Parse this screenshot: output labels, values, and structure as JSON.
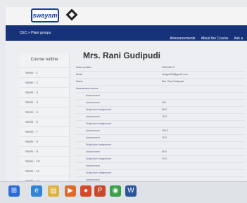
{
  "app": {
    "logo": "swayam",
    "breadcrumb": "CEC » Plant groups",
    "nav_links": [
      "Announcements",
      "About the Course",
      "Ask a"
    ]
  },
  "sidebar": {
    "title": "Course outline",
    "items": [
      "Week - 1",
      "Week - 2",
      "Week - 3",
      "Week - 4",
      "Week - 5",
      "Week - 6",
      "Week - 7",
      "Week - 8",
      "Week - 9",
      "Week - 10",
      "Week - 11",
      "Week - 12"
    ]
  },
  "profile": {
    "name": "Mrs. Rani Gudipudi",
    "rows": [
      {
        "label": "Date enrolled",
        "value": "2020-08-22",
        "sub": false
      },
      {
        "label": "Email",
        "value": "ranigudi78@gmail.com",
        "sub": false
      },
      {
        "label": "Name",
        "value": "Mrs. Rani Gudipudi",
        "sub": false
      },
      {
        "label": "Assessment scores",
        "value": "",
        "sub": false
      },
      {
        "label": "Assessment",
        "value": "",
        "sub": true
      },
      {
        "label": "Assessment",
        "value": "100",
        "sub": true
      },
      {
        "label": "Subjective Assignment",
        "value": "50.0",
        "sub": true
      },
      {
        "label": "Assessment",
        "value": "70.0",
        "sub": true
      },
      {
        "label": "Subjective Assignment",
        "value": "",
        "sub": true
      },
      {
        "label": "Assessment",
        "value": "100.0",
        "sub": true
      },
      {
        "label": "Assessment",
        "value": "70.0",
        "sub": true
      },
      {
        "label": "Subjective Assignment",
        "value": "",
        "sub": true
      },
      {
        "label": "Assessment",
        "value": "50.0",
        "sub": true
      },
      {
        "label": "Subjective Assignment",
        "value": "70.0",
        "sub": true
      },
      {
        "label": "Assessment",
        "value": "",
        "sub": true
      },
      {
        "label": "Subjective Assignment",
        "value": "",
        "sub": true
      },
      {
        "label": "Assessment",
        "value": "",
        "sub": true
      },
      {
        "label": "Subjective Assignment",
        "value": "",
        "sub": true
      },
      {
        "label": "Subjective Assignment",
        "value": "",
        "sub": true
      }
    ]
  },
  "taskbar": {
    "icons": [
      {
        "name": "start-icon",
        "glyph": "⊞",
        "color": "#2b6cd6"
      },
      {
        "name": "ie-icon",
        "glyph": "e",
        "color": "#2f86d8"
      },
      {
        "name": "folder-icon",
        "glyph": "▤",
        "color": "#e0b23b"
      },
      {
        "name": "media-icon",
        "glyph": "▶",
        "color": "#e06a2a"
      },
      {
        "name": "firefox-icon",
        "glyph": "●",
        "color": "#d44a2a"
      },
      {
        "name": "powerpoint-icon",
        "glyph": "P",
        "color": "#c9472b"
      },
      {
        "name": "chrome-icon",
        "glyph": "◉",
        "color": "#3aa04a"
      },
      {
        "name": "word-icon",
        "glyph": "W",
        "color": "#2b579a"
      }
    ]
  }
}
